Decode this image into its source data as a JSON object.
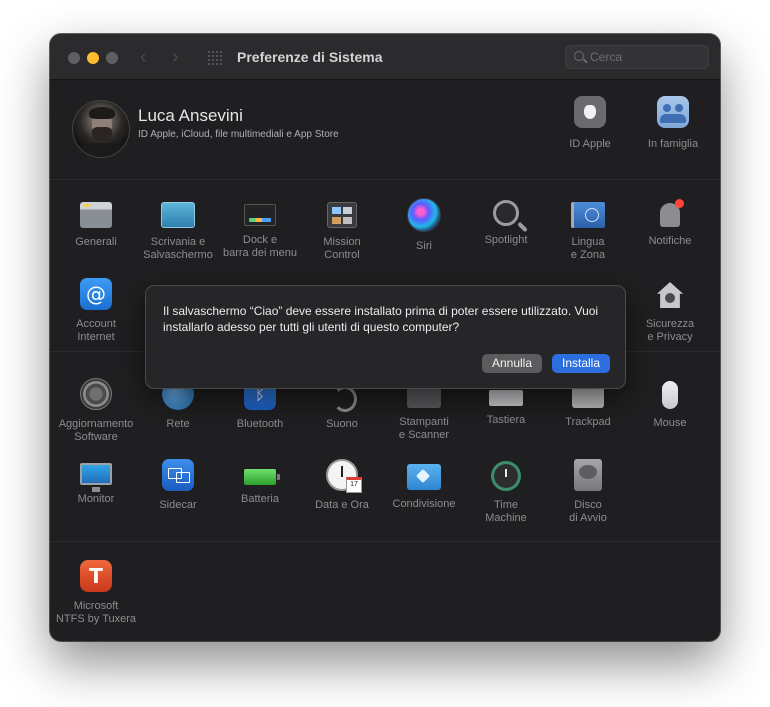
{
  "window": {
    "title": "Preferenze di Sistema",
    "search_placeholder": "Cerca",
    "accent_color": "#2c6ee0"
  },
  "user": {
    "name": "Luca Ansevini",
    "subtitle": "ID Apple, iCloud, file multimediali e App Store",
    "top_items": [
      {
        "label": "ID Apple",
        "icon": "apple-id-icon"
      },
      {
        "label": "In famiglia",
        "icon": "family-sharing-icon"
      }
    ]
  },
  "section1": {
    "row1": [
      {
        "label": "Generali",
        "icon": "general-icon"
      },
      {
        "label": "Scrivania e\nSalvaschermo",
        "icon": "desktop-screensaver-icon"
      },
      {
        "label": "Dock e\nbarra dei menu",
        "icon": "dock-icon"
      },
      {
        "label": "Mission\nControl",
        "icon": "mission-control-icon"
      },
      {
        "label": "Siri",
        "icon": "siri-icon"
      },
      {
        "label": "Spotlight",
        "icon": "spotlight-icon"
      },
      {
        "label": "Lingua\ne Zona",
        "icon": "language-region-icon"
      },
      {
        "label": "Notifiche",
        "icon": "notifications-icon"
      }
    ],
    "row2": [
      {
        "label": "Account\nInternet",
        "icon": "internet-accounts-icon"
      },
      {
        "label": "Sicurezza\ne Privacy",
        "icon": "security-privacy-icon"
      }
    ]
  },
  "section2": {
    "row1": [
      {
        "label": "Aggiornamento\nSoftware",
        "icon": "software-update-icon"
      },
      {
        "label": "Rete",
        "icon": "network-icon"
      },
      {
        "label": "Bluetooth",
        "icon": "bluetooth-icon"
      },
      {
        "label": "Suono",
        "icon": "sound-icon"
      },
      {
        "label": "Stampanti\ne Scanner",
        "icon": "printers-scanners-icon"
      },
      {
        "label": "Tastiera",
        "icon": "keyboard-icon"
      },
      {
        "label": "Trackpad",
        "icon": "trackpad-icon"
      },
      {
        "label": "Mouse",
        "icon": "mouse-icon"
      }
    ],
    "row2": [
      {
        "label": "Monitor",
        "icon": "displays-icon"
      },
      {
        "label": "Sidecar",
        "icon": "sidecar-icon"
      },
      {
        "label": "Batteria",
        "icon": "battery-icon"
      },
      {
        "label": "Data e Ora",
        "icon": "date-time-icon"
      },
      {
        "label": "Condivisione",
        "icon": "sharing-icon"
      },
      {
        "label": "Time\nMachine",
        "icon": "time-machine-icon"
      },
      {
        "label": "Disco\ndi Avvio",
        "icon": "startup-disk-icon"
      }
    ]
  },
  "section3": {
    "items": [
      {
        "label": "Microsoft\nNTFS by Tuxera",
        "icon": "tuxera-ntfs-icon",
        "glyph": "T"
      }
    ]
  },
  "alert": {
    "message": "Il salvaschermo “Ciao” deve essere installato prima di poter essere utilizzato. Vuoi installarlo adesso per tutti gli utenti di questo computer?",
    "cancel_label": "Annulla",
    "confirm_label": "Installa"
  },
  "glyphs": {
    "account": "@",
    "bluetooth": "ᛒ",
    "back": "‹",
    "forward": "›"
  }
}
